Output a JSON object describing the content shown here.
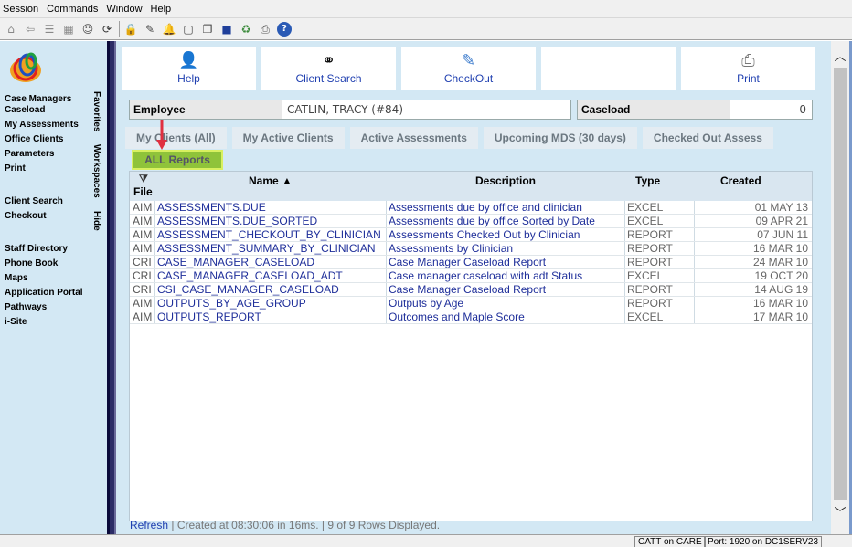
{
  "menu": [
    "Session",
    "Commands",
    "Window",
    "Help"
  ],
  "toolbar_icons": [
    "home-icon",
    "back-icon",
    "list-icon",
    "grid-icon",
    "people-icon",
    "cycle-icon",
    "lock-icon",
    "edit-icon",
    "bell-icon",
    "document-icon",
    "copy-icon",
    "folder-icon",
    "refresh-icon",
    "print-icon",
    "help-icon"
  ],
  "sidebar": {
    "items": [
      "Case Managers Caseload",
      "My Assessments",
      "Office Clients",
      "Parameters",
      "Print"
    ],
    "items2": [
      "Client Search",
      "Checkout"
    ],
    "items3": [
      "Staff Directory",
      "Phone Book",
      "Maps",
      "Application Portal",
      "Pathways",
      "i-Site"
    ],
    "vtabs": [
      "Favorites",
      "Workspaces",
      "Hide"
    ]
  },
  "buttons": [
    {
      "label": "Help",
      "icon": "help-person-icon"
    },
    {
      "label": "Client Search",
      "icon": "binoculars-icon"
    },
    {
      "label": "CheckOut",
      "icon": "checkout-icon"
    },
    {
      "label": "",
      "icon": ""
    },
    {
      "label": "Print",
      "icon": "printer-icon"
    }
  ],
  "employee": {
    "label": "Employee",
    "value": "CATLIN, TRACY (#84)"
  },
  "caseload": {
    "label": "Caseload",
    "value": "0"
  },
  "tabs": [
    "My Clients (All)",
    "My Active Clients",
    "Active Assessments",
    "Upcoming MDS (30 days)",
    "Checked Out Assess"
  ],
  "active_tab": "ALL Reports",
  "table": {
    "headers": {
      "file": "File",
      "name": "Name ▲",
      "description": "Description",
      "type": "Type",
      "created": "Created"
    },
    "rows": [
      {
        "file": "AIM",
        "name": "ASSESSMENTS.DUE",
        "description": "Assessments due by office and clinician",
        "type": "EXCEL",
        "created": "01 MAY 13"
      },
      {
        "file": "AIM",
        "name": "ASSESSMENTS.DUE_SORTED",
        "description": "Assessments due by office Sorted by Date",
        "type": "EXCEL",
        "created": "09 APR 21"
      },
      {
        "file": "AIM",
        "name": "ASSESSMENT_CHECKOUT_BY_CLINICIAN",
        "description": "Assessments Checked Out by Clinician",
        "type": "REPORT",
        "created": "07 JUN 11"
      },
      {
        "file": "AIM",
        "name": "ASSESSMENT_SUMMARY_BY_CLINICIAN",
        "description": "Assessments by Clinician",
        "type": "REPORT",
        "created": "16 MAR 10"
      },
      {
        "file": "CRI",
        "name": "CASE_MANAGER_CASELOAD",
        "description": "Case Manager Caseload Report",
        "type": "REPORT",
        "created": "24 MAR 10"
      },
      {
        "file": "CRI",
        "name": "CASE_MANAGER_CASELOAD_ADT",
        "description": "Case manager caseload with adt Status",
        "type": "EXCEL",
        "created": "19 OCT 20"
      },
      {
        "file": "CRI",
        "name": "CSI_CASE_MANAGER_CASELOAD",
        "description": "Case Manager Caseload Report",
        "type": "REPORT",
        "created": "14 AUG 19"
      },
      {
        "file": "AIM",
        "name": "OUTPUTS_BY_AGE_GROUP",
        "description": "Outputs by Age",
        "type": "REPORT",
        "created": "16 MAR 10"
      },
      {
        "file": "AIM",
        "name": "OUTPUTS_REPORT",
        "description": "Outcomes and Maple Score",
        "type": "EXCEL",
        "created": "17 MAR 10"
      }
    ]
  },
  "footer": {
    "refresh": "Refresh",
    "status": " | Created at 08:30:06 in 16ms. | 9 of 9 Rows Displayed."
  },
  "statusbar": {
    "session": "CATT on CARE",
    "port": "Port: 1920 on DC1SERV23"
  }
}
